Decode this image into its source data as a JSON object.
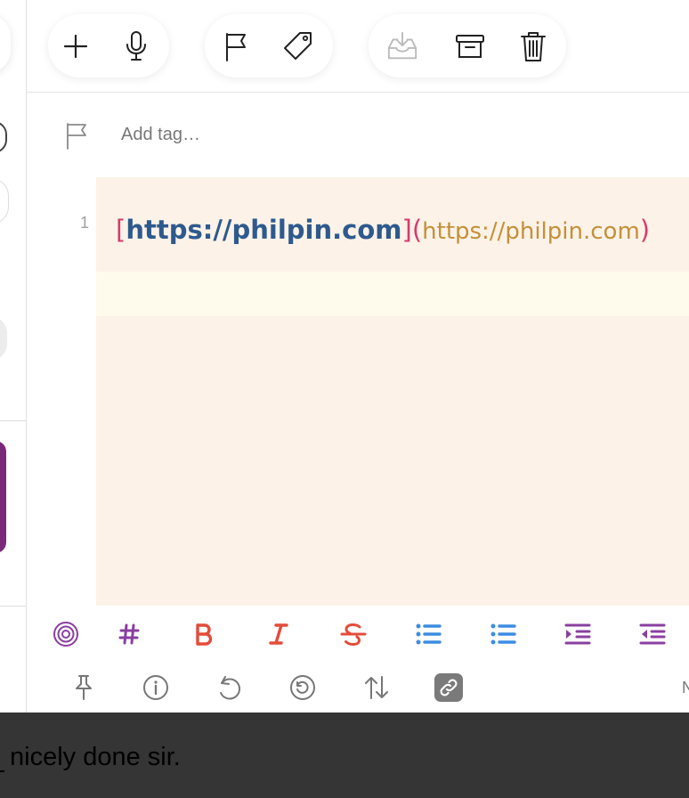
{
  "toolbar": {
    "groups": [
      [
        "plus-icon",
        "microphone-icon"
      ],
      [
        "flag-icon",
        "tag-icon"
      ],
      [
        "inbox-download-icon",
        "archive-icon",
        "trash-icon"
      ]
    ]
  },
  "tag_row": {
    "placeholder": "Add tag…"
  },
  "editor": {
    "line_number": "1",
    "link": {
      "open_bracket": "[",
      "text": "https://philpin.com",
      "close_bracket": "]",
      "open_paren": "(",
      "url": "https://philpin.com",
      "close_paren": ")"
    }
  },
  "format_bar": {
    "items": [
      "target-icon",
      "heading-hash-icon",
      "bold-icon",
      "italic-icon",
      "strikethrough-icon",
      "bulleted-list-icon",
      "numbered-list-icon",
      "indent-icon",
      "outdent-icon"
    ]
  },
  "bottom_bar": {
    "items": [
      "pin-icon",
      "info-icon",
      "undo-icon",
      "history-icon",
      "sort-icon",
      "link-icon"
    ],
    "trailing_text": "N"
  },
  "caption": {
    "text": "nicely done sir."
  },
  "colors": {
    "bracket": "#d63b6e",
    "link_text": "#2d5a8e",
    "link_url": "#c5903a",
    "editor_bg": "#fcf2e7",
    "format_accent_red": "#e34c3a",
    "format_accent_blue": "#3d8de0",
    "format_accent_purple": "#8a3fa0"
  }
}
